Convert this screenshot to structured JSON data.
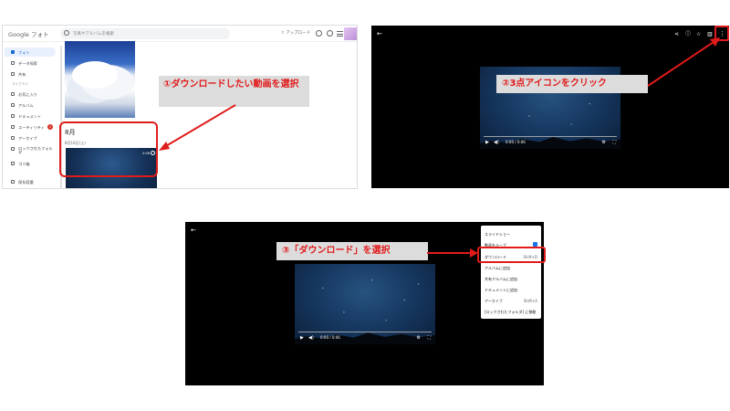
{
  "panel1": {
    "logo": "Google フォト",
    "search_placeholder": "写真やアルバムを検索",
    "upload_label": "アップロード",
    "sidebar": [
      {
        "label": "フォト"
      },
      {
        "label": "データ探索"
      },
      {
        "label": "共有"
      },
      {
        "section": "ライブラリ"
      },
      {
        "label": "お気に入り"
      },
      {
        "label": "アルバム"
      },
      {
        "label": "ドキュメント"
      },
      {
        "label": "ユーティリティ",
        "badge": "1"
      },
      {
        "label": "アーカイブ"
      },
      {
        "label": "ロックされたフォルダ"
      },
      {
        "label": "ゴミ箱"
      },
      {
        "label": "保存容量"
      }
    ],
    "month": "8月",
    "date": "8月16日(土)",
    "video_duration": "0:06",
    "callout": "①ダウンロードしたい動画を選択"
  },
  "panel2": {
    "callout": "②3点アイコンをクリック",
    "time": "0:00 / 0:06",
    "icons": [
      "back-icon",
      "share-icon",
      "info-icon",
      "star-icon",
      "trash-icon",
      "more-vert-icon"
    ]
  },
  "panel3": {
    "callout": "③「ダウンロード」を選択",
    "time": "0:00 / 0:06",
    "menu": [
      {
        "label": "スライドショー",
        "shortcut": ""
      },
      {
        "label": "動画をループ",
        "shortcut": "",
        "checked": true
      },
      {
        "label": "ダウンロード",
        "shortcut": "Shift+D"
      },
      {
        "label": "アルバムに追加",
        "shortcut": ""
      },
      {
        "label": "共有アルバムに追加",
        "shortcut": ""
      },
      {
        "label": "ドキュメントに追加",
        "shortcut": ""
      },
      {
        "label": "アーカイブ",
        "shortcut": "Shift+A"
      },
      {
        "label": "[ロックされたフォルダ] に移動",
        "shortcut": ""
      }
    ]
  },
  "colors": {
    "accent": "#e01b1b",
    "callout_bg": "#dcdcdc",
    "active_nav": "#1967d2"
  }
}
